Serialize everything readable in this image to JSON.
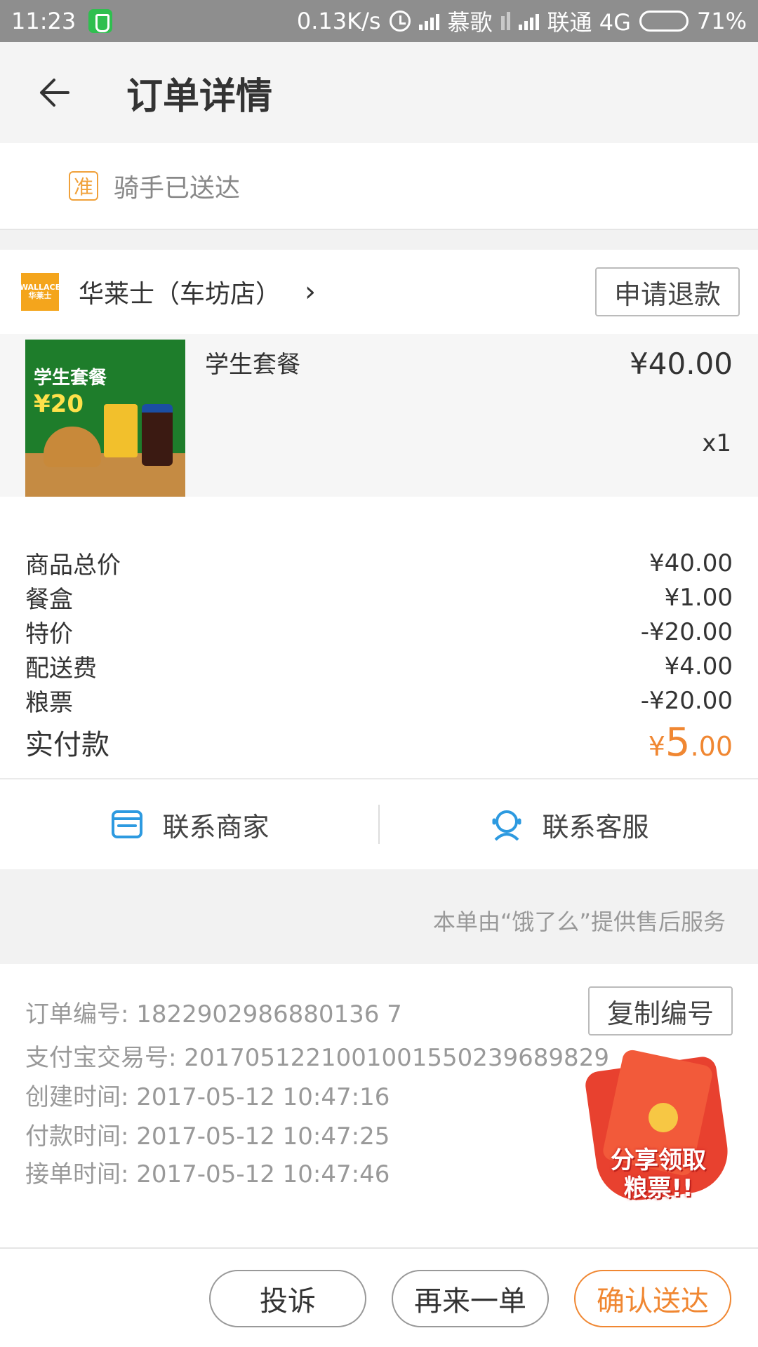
{
  "status_bar": {
    "time": "11:23",
    "speed": "0.13K/s",
    "carrier1": "慕歌",
    "carrier2": "联通 4G",
    "battery": "71%"
  },
  "header": {
    "title": "订单详情"
  },
  "order_status": {
    "badge": "准",
    "text": "骑手已送达"
  },
  "shop": {
    "logo_text": "WALLACE 华莱士",
    "name": "华莱士（车坊店）",
    "chevron": "›",
    "refund_label": "申请退款"
  },
  "item": {
    "thumb_title": "学生套餐",
    "thumb_price": "¥20",
    "name": "学生套餐",
    "price": "¥40.00",
    "qty": "x1"
  },
  "fees": [
    {
      "label": "商品总价",
      "value": "¥40.00"
    },
    {
      "label": "餐盒",
      "value": "¥1.00"
    },
    {
      "label": "特价",
      "value": "-¥20.00"
    },
    {
      "label": "配送费",
      "value": "¥4.00"
    },
    {
      "label": "粮票",
      "value": "-¥20.00"
    }
  ],
  "total": {
    "label": "实付款",
    "currency": "¥",
    "integer": "5",
    "decimal": ".00",
    "color": "#f08732"
  },
  "contact": {
    "merchant": "联系商家",
    "service": "联系客服"
  },
  "after_sales": "本单由“饿了么”提供售后服务",
  "order_info": {
    "order_no": "订单编号: 1822902986880136 7",
    "alipay_no": "支付宝交易号: 2017051221001001550239689829",
    "created": "创建时间: 2017-05-12 10:47:16",
    "paid": "付款时间: 2017-05-12 10:47:25",
    "accepted": "接单时间: 2017-05-12 10:47:46",
    "copy_label": "复制编号",
    "promo_line1": "分享领取",
    "promo_line2": "粮票!!"
  },
  "actions": {
    "complain": "投诉",
    "reorder": "再来一单",
    "confirm": "确认送达"
  },
  "colors": {
    "accent": "#f08732",
    "icon_blue": "#2d9ae0"
  }
}
